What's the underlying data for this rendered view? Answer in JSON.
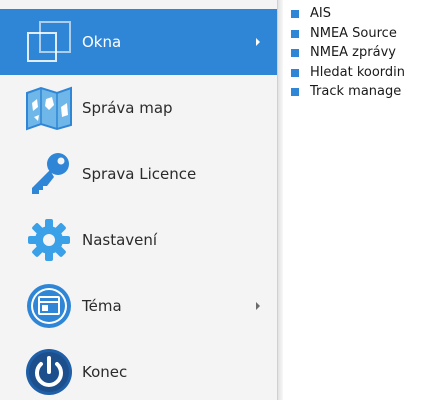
{
  "menu": {
    "items": [
      {
        "label": "Okna",
        "icon": "windows-icon",
        "has_submenu": true,
        "active": true
      },
      {
        "label": "Správa map",
        "icon": "map-icon",
        "has_submenu": false,
        "active": false
      },
      {
        "label": "Sprava Licence",
        "icon": "key-icon",
        "has_submenu": false,
        "active": false
      },
      {
        "label": "Nastavení",
        "icon": "gear-icon",
        "has_submenu": false,
        "active": false
      },
      {
        "label": "Téma",
        "icon": "theme-icon",
        "has_submenu": true,
        "active": false
      },
      {
        "label": "Konec",
        "icon": "power-icon",
        "has_submenu": false,
        "active": false
      }
    ]
  },
  "submenu": {
    "items": [
      {
        "label": "AIS"
      },
      {
        "label": "NMEA Source"
      },
      {
        "label": "NMEA zprávy"
      },
      {
        "label": "Hledat koordin"
      },
      {
        "label": "Track manage"
      }
    ]
  },
  "colors": {
    "accent": "#2f86d6",
    "menu_bg": "#f4f4f4",
    "text": "#2b2b2b"
  }
}
